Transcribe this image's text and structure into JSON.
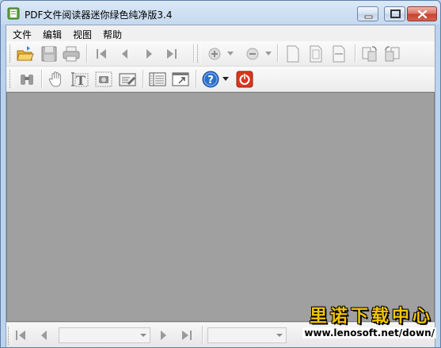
{
  "window": {
    "title": "PDF文件阅读器迷你绿色纯净版3.4"
  },
  "menu": {
    "items": [
      "文件",
      "编辑",
      "视图",
      "帮助"
    ]
  },
  "toolbar1": {
    "icons": [
      "open-folder-icon",
      "save-icon",
      "print-icon",
      "first-page-icon",
      "previous-page-icon",
      "next-page-icon",
      "last-page-icon",
      "zoom-in-icon",
      "zoom-out-icon",
      "actual-size-icon",
      "fit-page-icon",
      "fit-width-icon",
      "rotate-clockwise-icon",
      "rotate-counterclockwise-icon"
    ]
  },
  "toolbar2": {
    "icons": [
      "find-binoculars-icon",
      "hand-tool-icon",
      "text-select-icon",
      "snapshot-icon",
      "edit-icon",
      "continuous-view-icon",
      "fullscreen-icon",
      "help-icon",
      "power-icon"
    ]
  },
  "status": {
    "page_value": "",
    "zoom_value": ""
  },
  "watermark": {
    "title": "里诺下载中心",
    "url": "www.lenosoft.net/down/"
  },
  "colors": {
    "viewer_bg": "#a0a0a0",
    "icon_blue": "#2f6fc9",
    "power_red": "#d9361e",
    "watermark_yellow": "#f3c400"
  }
}
